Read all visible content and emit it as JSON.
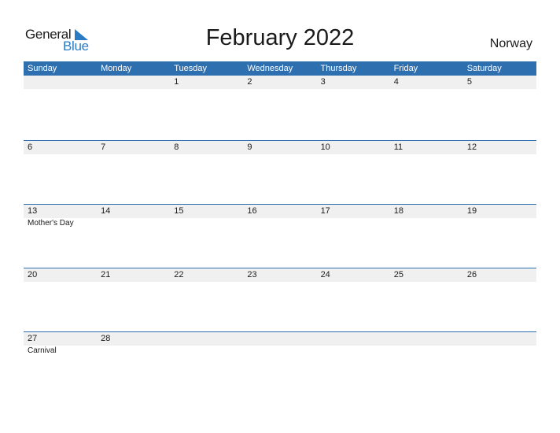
{
  "logo": {
    "line1": "General",
    "line2": "Blue"
  },
  "title": "February 2022",
  "country": "Norway",
  "colors": {
    "accent": "#2e6fb0",
    "strip": "#f0f0f0"
  },
  "weekdays": [
    "Sunday",
    "Monday",
    "Tuesday",
    "Wednesday",
    "Thursday",
    "Friday",
    "Saturday"
  ],
  "weeks": [
    [
      {
        "day": ""
      },
      {
        "day": ""
      },
      {
        "day": "1"
      },
      {
        "day": "2"
      },
      {
        "day": "3"
      },
      {
        "day": "4"
      },
      {
        "day": "5"
      }
    ],
    [
      {
        "day": "6"
      },
      {
        "day": "7"
      },
      {
        "day": "8"
      },
      {
        "day": "9"
      },
      {
        "day": "10"
      },
      {
        "day": "11"
      },
      {
        "day": "12"
      }
    ],
    [
      {
        "day": "13",
        "event": "Mother's Day"
      },
      {
        "day": "14"
      },
      {
        "day": "15"
      },
      {
        "day": "16"
      },
      {
        "day": "17"
      },
      {
        "day": "18"
      },
      {
        "day": "19"
      }
    ],
    [
      {
        "day": "20"
      },
      {
        "day": "21"
      },
      {
        "day": "22"
      },
      {
        "day": "23"
      },
      {
        "day": "24"
      },
      {
        "day": "25"
      },
      {
        "day": "26"
      }
    ],
    [
      {
        "day": "27",
        "event": "Carnival"
      },
      {
        "day": "28"
      },
      {
        "day": ""
      },
      {
        "day": ""
      },
      {
        "day": ""
      },
      {
        "day": ""
      },
      {
        "day": ""
      }
    ]
  ]
}
